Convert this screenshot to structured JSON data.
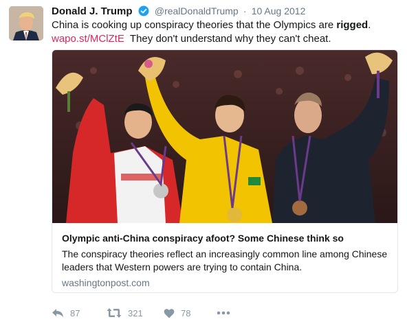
{
  "tweet": {
    "author_name": "Donald J. Trump",
    "handle": "@realDonaldTrump",
    "separator": "·",
    "date": "10 Aug 2012",
    "text_part1": "China is cooking up conspiracy theories that the Olympics are ",
    "text_bold": "rigged",
    "text_part2": ".",
    "link": "wapo.st/MClZtE",
    "text_part3": "  They don't understand why they can't cheat."
  },
  "card": {
    "title": "Olympic anti-China conspiracy afoot? Some Chinese think so",
    "description": "The conspiracy theories reflect an increasingly common line among Chinese leaders that Western powers are trying to contain China.",
    "domain": "washingtonpost.com"
  },
  "actions": {
    "reply_count": "87",
    "retweet_count": "321",
    "like_count": "78"
  },
  "colors": {
    "link": "#e0245e",
    "verified": "#1da1f2",
    "muted": "#8899a6"
  }
}
